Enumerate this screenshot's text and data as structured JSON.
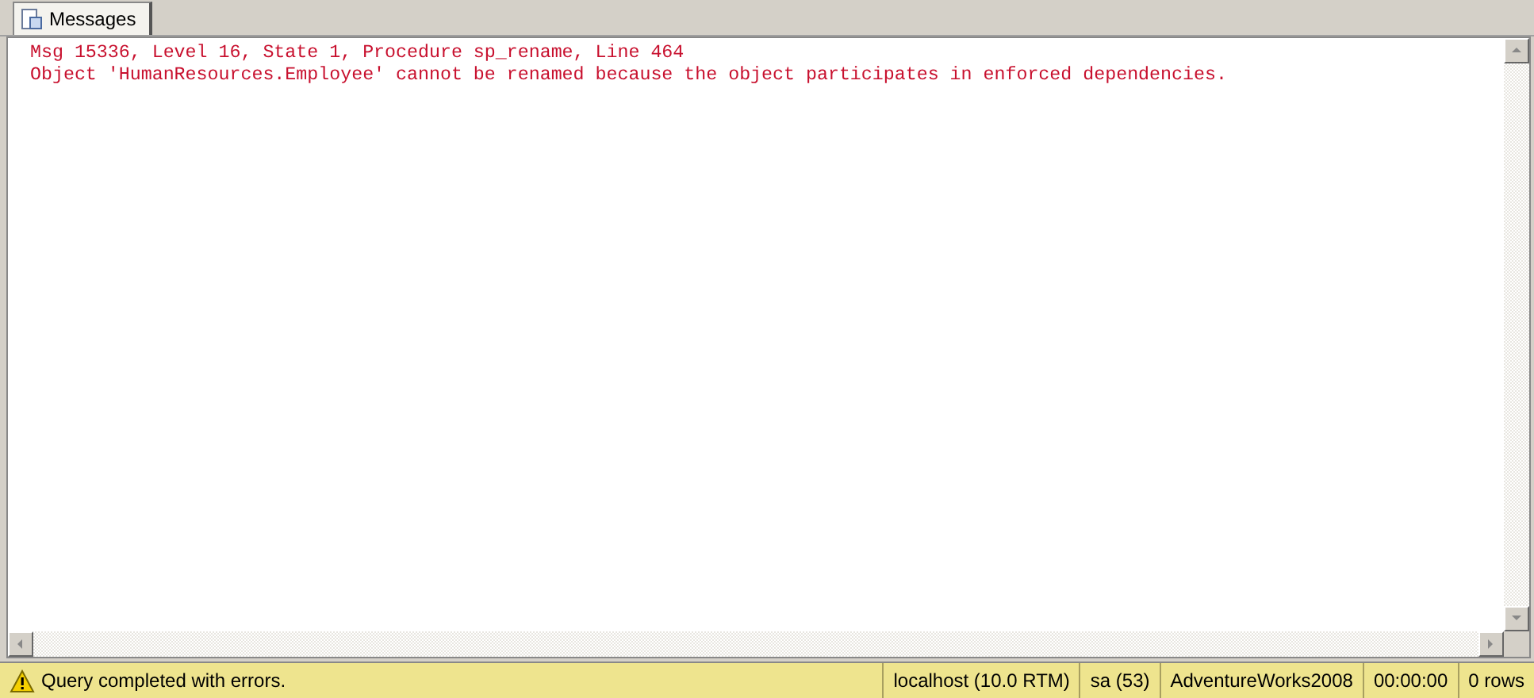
{
  "tabs": [
    {
      "label": "Messages",
      "selected": true
    }
  ],
  "messages": [
    {
      "text": "Msg 15336, Level 16, State 1, Procedure sp_rename, Line 464",
      "kind": "error"
    },
    {
      "text": "Object 'HumanResources.Employee' cannot be renamed because the object participates in enforced dependencies.",
      "kind": "error"
    }
  ],
  "status_bar": {
    "message": "Query completed with errors.",
    "kind": "warning",
    "panels": [
      "localhost (10.0 RTM)",
      "sa (53)",
      "AdventureWorks2008",
      "00:00:00",
      "0 rows"
    ]
  }
}
